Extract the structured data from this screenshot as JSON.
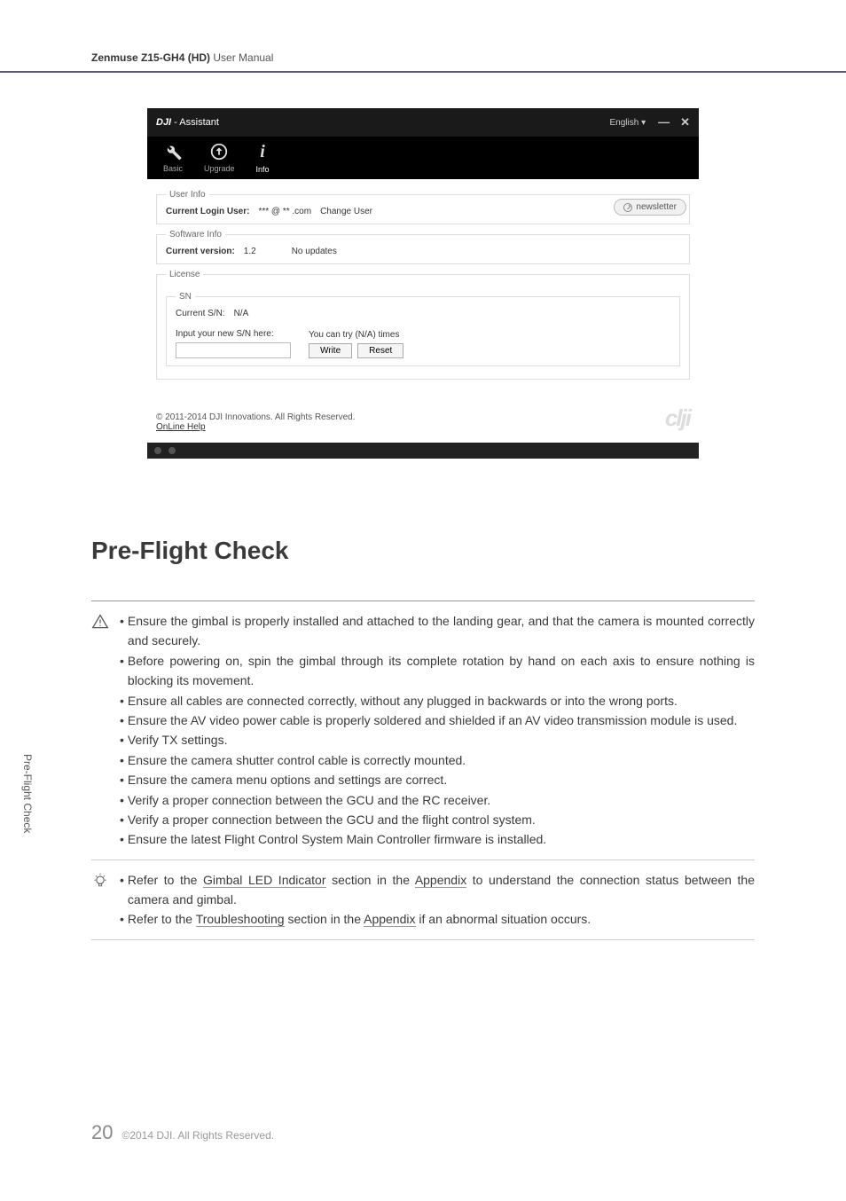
{
  "header": {
    "bold": "Zenmuse Z15-GH4 (HD)",
    "rest": " User Manual"
  },
  "assistant": {
    "title_bold": "DJI",
    "title_rest": " - Assistant",
    "language": "English",
    "tabs": {
      "basic": "Basic",
      "upgrade": "Upgrade",
      "info": "Info"
    },
    "user_info": {
      "legend": "User Info",
      "label": "Current Login User:",
      "value": "*** @ ** .com",
      "change": "Change User"
    },
    "newsletter": "newsletter",
    "software_info": {
      "legend": "Software Info",
      "label": "Current version:",
      "version": "1.2",
      "status": "No updates"
    },
    "license": {
      "legend": "License",
      "sn_legend": "SN",
      "current_sn_label": "Current S/N:",
      "current_sn_value": "N/A",
      "input_label": "Input your new S/N here:",
      "tries": "You can try (N/A) times",
      "write": "Write",
      "reset": "Reset"
    },
    "copyright": "© 2011-2014 DJI Innovations. All Rights Reserved.",
    "online_help": "OnLine Help",
    "logo": "clji"
  },
  "section_title": "Pre-Flight Check",
  "warnings": [
    "Ensure the gimbal is properly installed and attached to the landing gear, and that the camera is mounted correctly and securely.",
    "Before powering on, spin the gimbal through its complete rotation by hand on each axis to ensure nothing is blocking its movement.",
    "Ensure all cables are connected correctly, without any plugged in backwards or into the wrong ports.",
    "Ensure the AV video power cable is properly soldered and shielded if an AV video transmission module is used.",
    "Verify TX settings.",
    "Ensure the camera shutter control cable is correctly mounted.",
    "Ensure the camera menu options and settings are correct.",
    "Verify a proper connection between the GCU and the RC receiver.",
    "Verify a proper connection between the GCU and the flight control system.",
    "Ensure the latest Flight Control System Main Controller firmware is installed."
  ],
  "tips": {
    "t1_a": "Refer to the ",
    "t1_b": "Gimbal LED Indicator",
    "t1_c": " section in the ",
    "t1_d": "Appendix",
    "t1_e": " to understand the connection status between the camera and gimbal.",
    "t2_a": "Refer to the ",
    "t2_b": "Troubleshooting",
    "t2_c": " section in the ",
    "t2_d": "Appendix",
    "t2_e": " if an abnormal situation occurs."
  },
  "side_tab": "Pre-Flight Check",
  "footer": {
    "page": "20",
    "copy": "©2014 DJI. All Rights Reserved."
  }
}
